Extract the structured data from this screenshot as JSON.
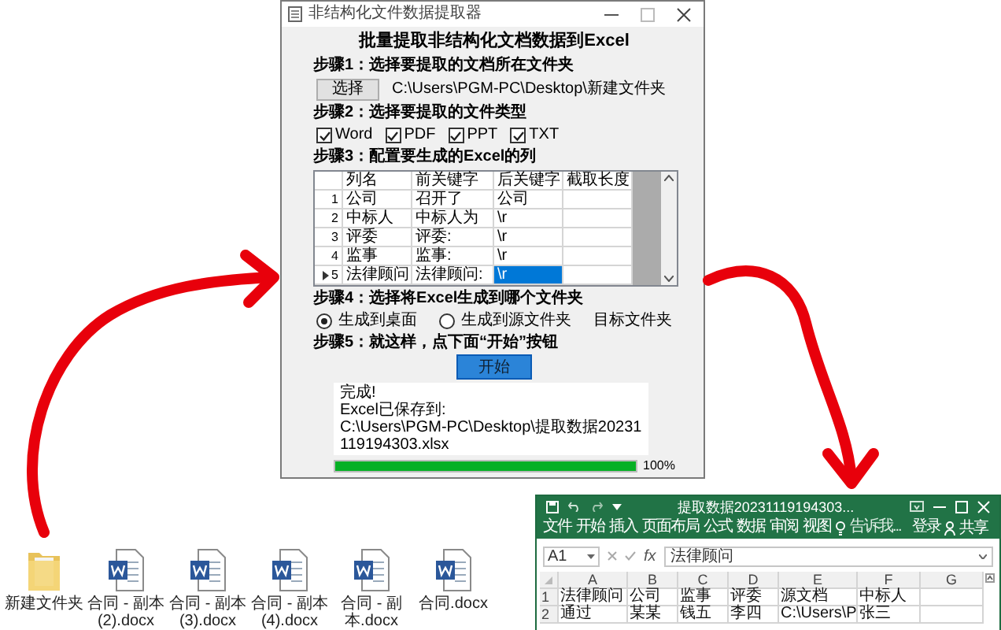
{
  "app_window": {
    "title": "非结构化文件数据提取器",
    "heading": "批量提取非结构化文档数据到Excel",
    "step1": {
      "label": "步骤1：选择要提取的文档所在文件夹",
      "button": "选择",
      "path": "C:\\Users\\PGM-PC\\Desktop\\新建文件夹"
    },
    "step2": {
      "label": "步骤2：选择要提取的文件类型",
      "file_types": [
        {
          "label": "Word",
          "checked": true
        },
        {
          "label": "PDF",
          "checked": true
        },
        {
          "label": "PPT",
          "checked": true
        },
        {
          "label": "TXT",
          "checked": true
        }
      ]
    },
    "step3": {
      "label": "步骤3：配置要生成的Excel的列",
      "table": {
        "columns": [
          "列名",
          "前关键字",
          "后关键字",
          "截取长度"
        ],
        "rows": [
          {
            "number": "1",
            "current": false,
            "cells": [
              {
                "text": "公司",
                "selected": false
              },
              {
                "text": "召开了",
                "selected": false
              },
              {
                "text": "公司",
                "selected": false
              }
            ]
          },
          {
            "number": "2",
            "current": false,
            "cells": [
              {
                "text": "中标人",
                "selected": false
              },
              {
                "text": "中标人为",
                "selected": false
              },
              {
                "text": "\\r",
                "selected": false
              }
            ]
          },
          {
            "number": "3",
            "current": false,
            "cells": [
              {
                "text": "评委",
                "selected": false
              },
              {
                "text": "评委:",
                "selected": false
              },
              {
                "text": "\\r",
                "selected": false
              }
            ]
          },
          {
            "number": "4",
            "current": false,
            "cells": [
              {
                "text": "监事",
                "selected": false
              },
              {
                "text": "监事:",
                "selected": false
              },
              {
                "text": "\\r",
                "selected": false
              }
            ]
          },
          {
            "number": "5",
            "current": true,
            "cells": [
              {
                "text": "法律顾问",
                "selected": false
              },
              {
                "text": "法律顾问:",
                "selected": false
              },
              {
                "text": "\\r",
                "selected": true
              }
            ]
          }
        ]
      }
    },
    "step4": {
      "label": "步骤4：选择将Excel生成到哪个文件夹",
      "options": [
        {
          "label": "生成到桌面",
          "selected": true
        },
        {
          "label": "生成到源文件夹",
          "selected": false
        }
      ],
      "target_label": "目标文件夹"
    },
    "step5": {
      "label": "步骤5：就这样，点下面“开始”按钮",
      "button": "开始"
    },
    "log": [
      "完成!",
      "Excel已保存到:",
      "C:\\Users\\PGM-PC\\Desktop\\提取数据20231119194303.xlsx"
    ],
    "progress": {
      "level": 1,
      "reading": "100%"
    }
  },
  "desktop_files": [
    {
      "kind": "folder",
      "name": "新建文件夹"
    },
    {
      "kind": "document",
      "name": "合同 - 副本 (2).docx"
    },
    {
      "kind": "document",
      "name": "合同 - 副本 (3).docx"
    },
    {
      "kind": "document",
      "name": "合同 - 副本 (4).docx"
    },
    {
      "kind": "document",
      "name": "合同 - 副本.docx"
    },
    {
      "kind": "document",
      "name": "合同.docx"
    }
  ],
  "excel_window": {
    "title": "提取数据20231119194303...",
    "ribbon_tabs": [
      "文件",
      "开始",
      "插入",
      "页面布局",
      "公式",
      "数据",
      "审阅",
      "视图"
    ],
    "tell_me": "告诉我...",
    "sign_in": "登录",
    "share": "共享",
    "name_box": "A1",
    "function_symbol": "fx",
    "formula": "法律顾问",
    "columns": [
      "A",
      "B",
      "C",
      "D",
      "E",
      "F",
      "G"
    ],
    "rows": [
      {
        "number": "1",
        "cells": [
          "法律顾问",
          "公司",
          "监事",
          "评委",
          "源文档",
          "中标人"
        ]
      },
      {
        "number": "2",
        "cells": [
          "通过",
          "某某",
          "钱五",
          "李四",
          "C:\\Users\\P",
          "张三"
        ]
      }
    ]
  }
}
